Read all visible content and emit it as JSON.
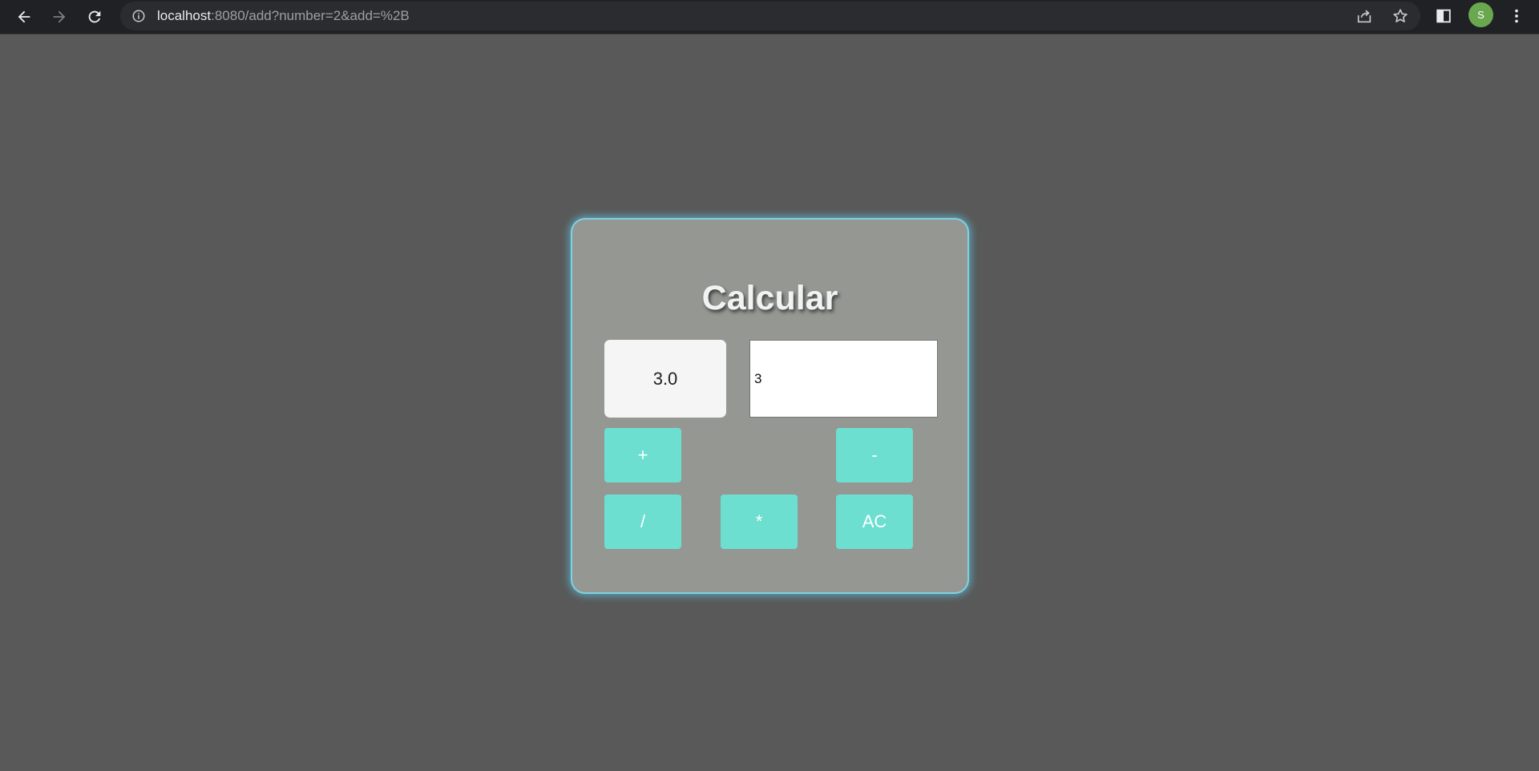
{
  "browser": {
    "url_host": "localhost",
    "url_rest": ":8080/add?number=2&add=%2B",
    "avatar_initial": "S"
  },
  "calculator": {
    "title": "Calcular",
    "result": "3.0",
    "input_value": "3",
    "buttons": {
      "add": "+",
      "subtract": "-",
      "divide": "/",
      "multiply": "*",
      "clear": "AC"
    }
  },
  "colors": {
    "page_background": "#595959",
    "card_background": "#949792",
    "card_glow": "#7fd1e3",
    "button": "#6cdfd1"
  }
}
